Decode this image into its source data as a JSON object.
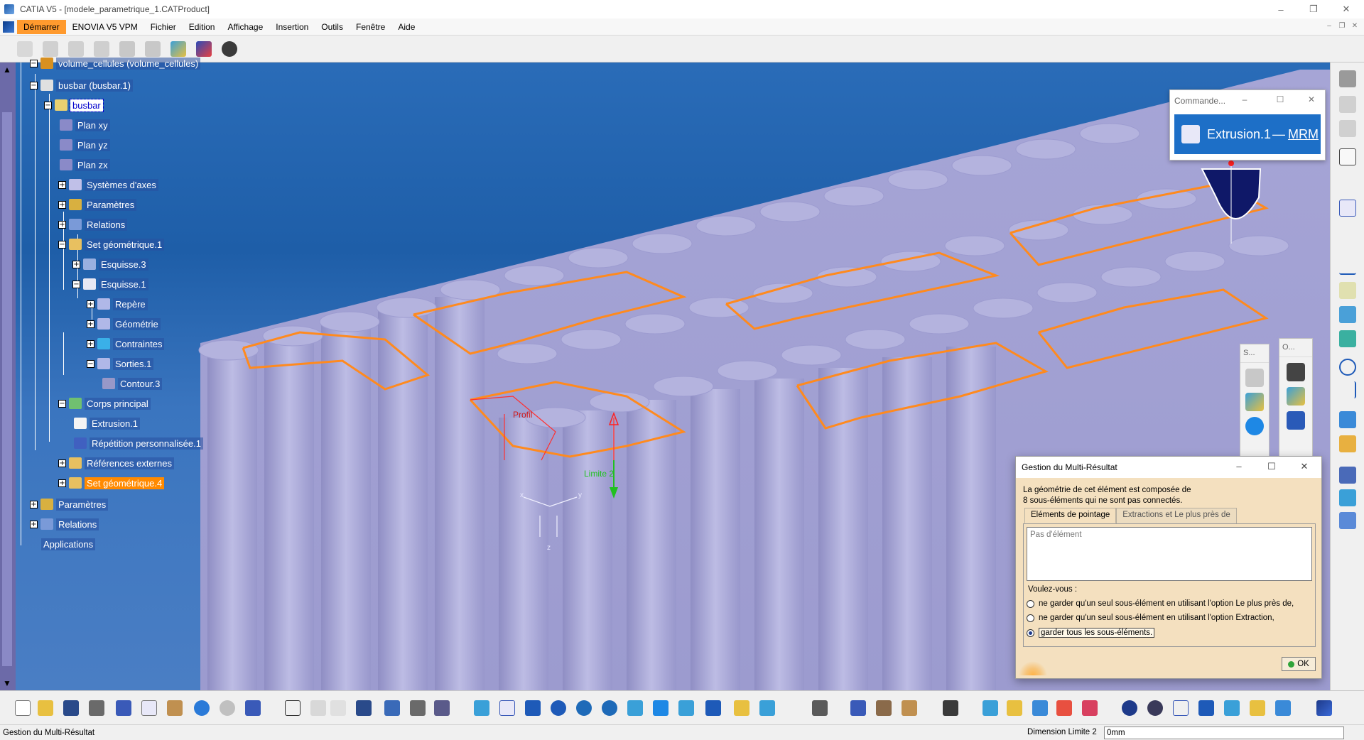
{
  "window": {
    "title": "CATIA V5 - [modele_parametrique_1.CATProduct]",
    "controls": [
      "–",
      "❐",
      "✕"
    ]
  },
  "menu": {
    "items": [
      "Démarrer",
      "ENOVIA V5 VPM",
      "Fichier",
      "Edition",
      "Affichage",
      "Insertion",
      "Outils",
      "Fenêtre",
      "Aide"
    ]
  },
  "tree": {
    "nodes": [
      {
        "label": "volume_cellules (volume_cellules)"
      },
      {
        "label": "busbar (busbar.1)"
      },
      {
        "label": "busbar"
      },
      {
        "label": "Plan xy"
      },
      {
        "label": "Plan yz"
      },
      {
        "label": "Plan zx"
      },
      {
        "label": "Systèmes d'axes"
      },
      {
        "label": "Paramètres"
      },
      {
        "label": "Relations"
      },
      {
        "label": "Set géométrique.1"
      },
      {
        "label": "Esquisse.3"
      },
      {
        "label": "Esquisse.1"
      },
      {
        "label": "Repère"
      },
      {
        "label": "Géométrie"
      },
      {
        "label": "Contraintes"
      },
      {
        "label": "Sorties.1"
      },
      {
        "label": "Contour.3"
      },
      {
        "label": "Corps principal"
      },
      {
        "label": "Extrusion.1"
      },
      {
        "label": "Répétition personnalisée.1"
      },
      {
        "label": "Références externes"
      },
      {
        "label": "Set géométrique.4"
      },
      {
        "label": "Paramètres"
      },
      {
        "label": "Relations"
      },
      {
        "label": "Applications"
      }
    ]
  },
  "viewport": {
    "labels": {
      "profil": "Profil",
      "limite": "Limite 2"
    },
    "axis_labels": {
      "x": "x",
      "y": "y",
      "z": "z"
    }
  },
  "command_panel": {
    "title": "Commande...",
    "feature": "Extrusion.1",
    "suffix": "MRM"
  },
  "mini_toolbars": {
    "s_title": "S...",
    "o_title": "O..."
  },
  "dialog": {
    "title": "Gestion du Multi-Résultat",
    "message_line1": "La géométrie de cet élément est composée de",
    "message_line2": "8 sous-éléments qui ne sont pas connectés.",
    "tabs": [
      "Eléments de pointage",
      "Extractions et Le plus près de"
    ],
    "list_placeholder": "Pas d'élément",
    "question": "Voulez-vous :",
    "options": [
      "ne garder qu'un seul sous-élément en utilisant l'option Le plus près de,",
      "ne garder qu'un seul sous-élément en utilisant l'option Extraction,",
      "garder tous les sous-éléments."
    ],
    "selected_option": 2,
    "ok_label": "OK"
  },
  "status": {
    "text": "Gestion du Multi-Résultat",
    "input_label": "Dimension Limite 2",
    "input_value": "0mm"
  },
  "colors": {
    "viewport_blue": "#1e5ea8",
    "cell_lavender": "#a9a8d8",
    "busbar_orange": "#ff8a1e",
    "selection_orange": "#ff9a2e",
    "dialog_bg": "#f4e0bf"
  }
}
